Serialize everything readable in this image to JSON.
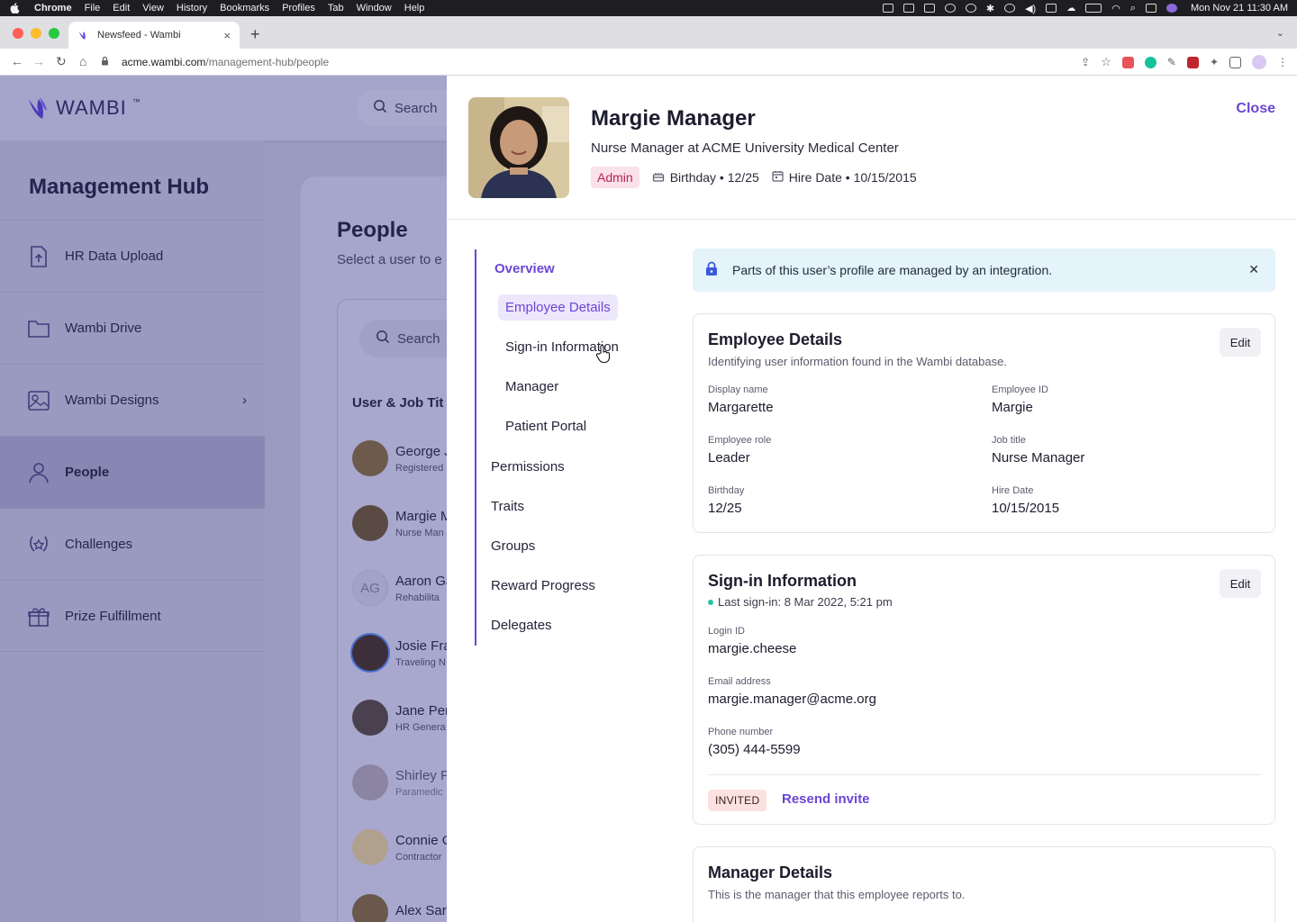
{
  "menubar": {
    "app_name": "Chrome",
    "items": [
      "File",
      "Edit",
      "View",
      "History",
      "Bookmarks",
      "Profiles",
      "Tab",
      "Window",
      "Help"
    ],
    "clock": "Mon Nov 21  11:30 AM"
  },
  "browser": {
    "tab_title": "Newsfeed - Wambi",
    "url_host": "acme.wambi.com",
    "url_path": "/management-hub/people"
  },
  "app": {
    "logo_text": "WAMBI",
    "logo_tm": "™",
    "search_placeholder": "Search",
    "sidebar": {
      "title": "Management Hub",
      "items": [
        {
          "label": "HR Data Upload",
          "icon": "upload-file-icon"
        },
        {
          "label": "Wambi Drive",
          "icon": "folder-icon"
        },
        {
          "label": "Wambi Designs",
          "icon": "image-icon"
        },
        {
          "label": "People",
          "icon": "person-icon"
        },
        {
          "label": "Challenges",
          "icon": "laurel-icon"
        },
        {
          "label": "Prize Fulfillment",
          "icon": "gift-icon"
        }
      ]
    },
    "people": {
      "title": "People",
      "subtitle": "Select a user to e",
      "search_placeholder": "Search",
      "column_header": "User & Job Tit",
      "rows": [
        {
          "name": "George J",
          "role": "Registered"
        },
        {
          "name": "Margie M",
          "role": "Nurse Man"
        },
        {
          "name": "Aaron Ga",
          "role": "Rehabilita",
          "initials": "AG"
        },
        {
          "name": "Josie Fra",
          "role": "Traveling N"
        },
        {
          "name": "Jane Per",
          "role": "HR Genera"
        },
        {
          "name": "Shirley F",
          "role": "Paramedic"
        },
        {
          "name": "Connie C",
          "role": "Contractor"
        },
        {
          "name": "Alex Sar",
          "role": ""
        }
      ]
    }
  },
  "drawer": {
    "name": "Margie Manager",
    "title": "Nurse Manager at ACME University Medical Center",
    "badge": "Admin",
    "birthday": "Birthday • 12/25",
    "hire_date": "Hire Date • 10/15/2015",
    "close_label": "Close",
    "nav": {
      "overview": "Overview",
      "sub": [
        "Employee Details",
        "Sign-in Information",
        "Manager",
        "Patient Portal"
      ],
      "items": [
        "Permissions",
        "Traits",
        "Groups",
        "Reward Progress",
        "Delegates"
      ]
    },
    "banner": "Parts of this user’s profile are managed by an integration.",
    "employee_details": {
      "title": "Employee Details",
      "subtitle": "Identifying user information found in the Wambi database.",
      "edit_label": "Edit",
      "fields": [
        {
          "label": "Display name",
          "value": "Margarette"
        },
        {
          "label": "Employee ID",
          "value": "Margie"
        },
        {
          "label": "Employee role",
          "value": "Leader"
        },
        {
          "label": "Job title",
          "value": "Nurse Manager"
        },
        {
          "label": "Birthday",
          "value": "12/25"
        },
        {
          "label": "Hire Date",
          "value": "10/15/2015"
        }
      ]
    },
    "signin": {
      "title": "Sign-in Information",
      "last_signin": "Last sign-in: 8 Mar 2022, 5:21 pm",
      "edit_label": "Edit",
      "fields": [
        {
          "label": "Login ID",
          "value": "margie.cheese"
        },
        {
          "label": "Email address",
          "value": "margie.manager@acme.org"
        },
        {
          "label": "Phone number",
          "value": "(305) 444-5599"
        }
      ],
      "status": "INVITED",
      "resend_label": "Resend invite"
    },
    "manager": {
      "title": "Manager Details",
      "subtitle": "This is the manager that this employee reports to."
    }
  },
  "colors": {
    "accent": "#6b46d6",
    "admin_badge_bg": "#fbe1ea",
    "banner_bg": "#e4f4fa",
    "invited_bg": "#fbe1e0",
    "status_dot": "#28c2a0"
  }
}
